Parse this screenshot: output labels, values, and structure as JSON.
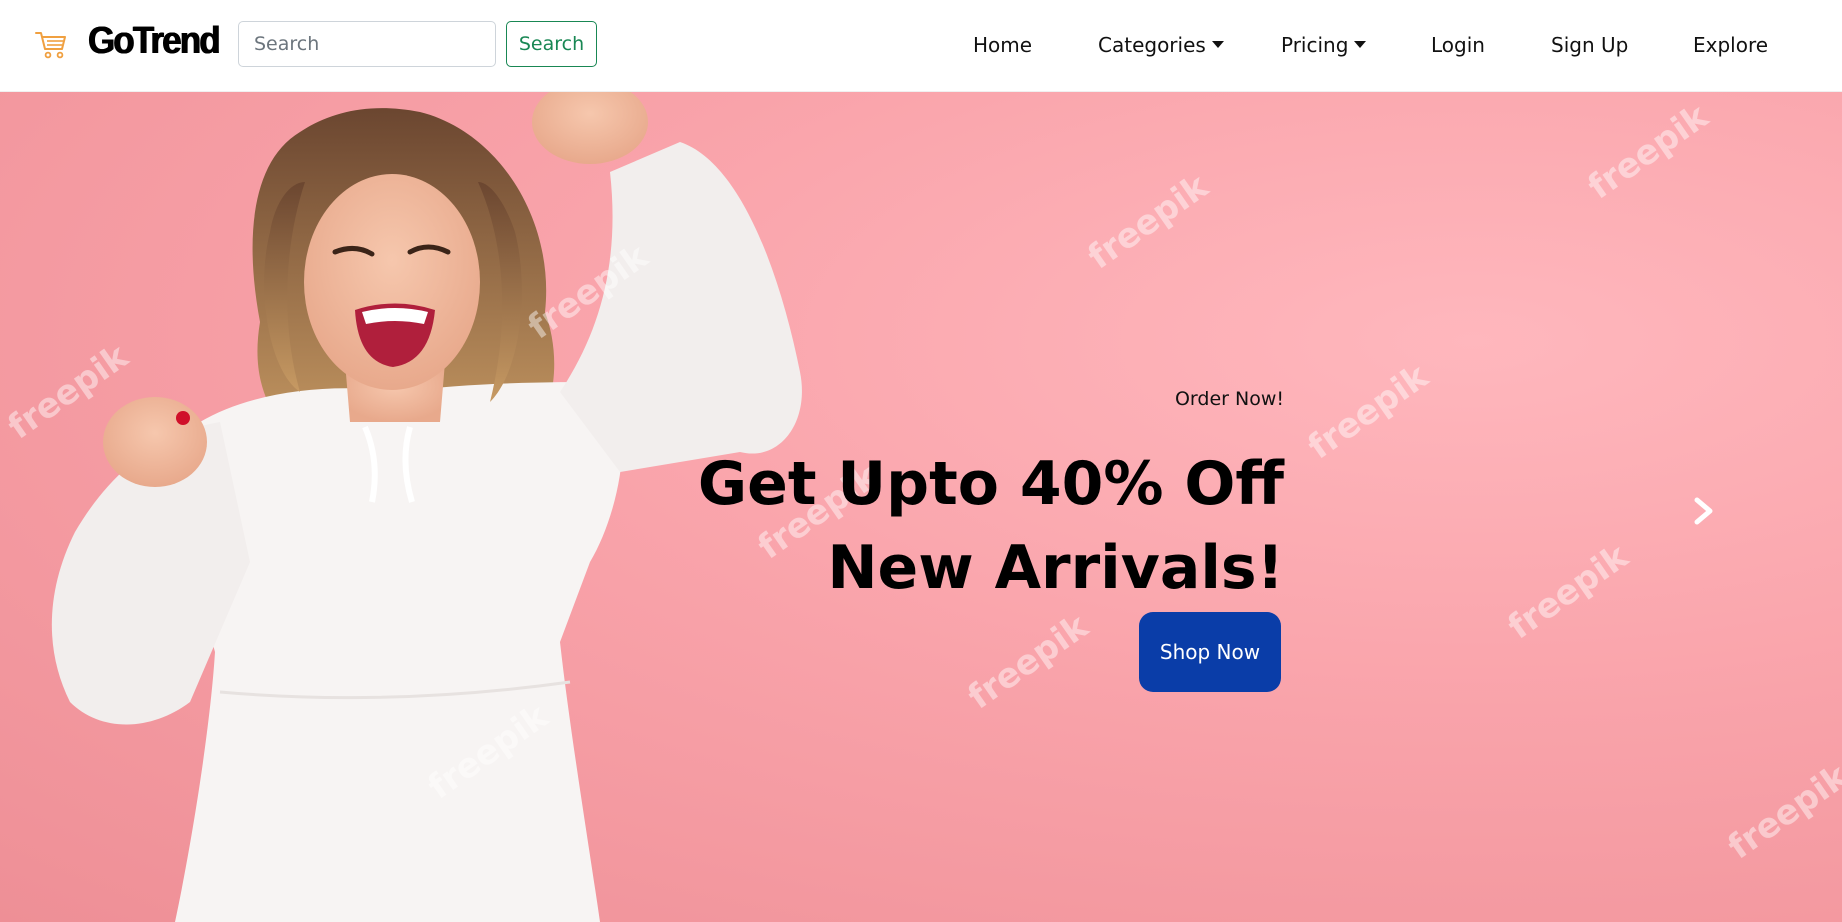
{
  "navbar": {
    "brand": "GoTrend",
    "search": {
      "placeholder": "Search",
      "value": "",
      "button_label": "Search"
    },
    "links": {
      "home": "Home",
      "categories": "Categories",
      "pricing": "Pricing",
      "login": "Login",
      "signup": "Sign Up",
      "explore": "Explore"
    },
    "icons": {
      "logo": "shopping-cart-icon",
      "dropdown": "caret-down-icon"
    }
  },
  "hero": {
    "subtitle": "Order Now!",
    "title_line1": "Get Upto 40% Off",
    "title_line2": "New Arrivals!",
    "cta_label": "Shop Now",
    "watermark": "freepik",
    "icons": {
      "next": "chevron-right-icon"
    }
  },
  "colors": {
    "cta_background": "#0a3da8",
    "search_button_accent": "#198754",
    "cart_icon": "#f0a040",
    "hero_background": "#f9a3aa"
  }
}
